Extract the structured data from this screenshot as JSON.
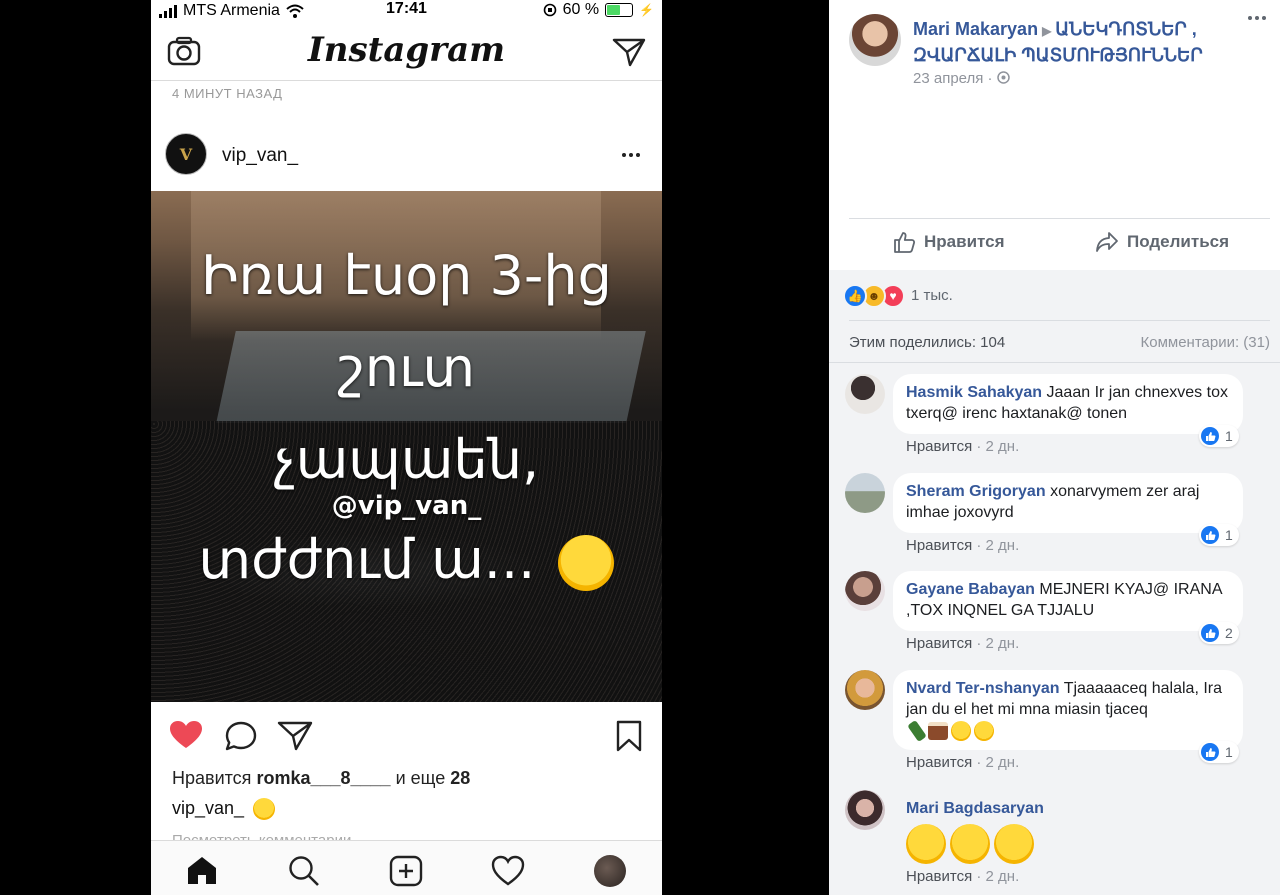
{
  "status_bar": {
    "carrier": "MTS Armenia",
    "time": "17:41",
    "battery": "60 %"
  },
  "instagram": {
    "logo": "Instagram",
    "posted_ago": "4 МИНУТ НАЗАД",
    "username": "vip_van_",
    "avatar_letter": "V",
    "overlay": {
      "line1": "Իռա էսօր 3-ից",
      "line2": "շուտ",
      "line3": "չապաեն,",
      "handle": "@vip_van_",
      "line4": "տժժում ա..."
    },
    "likes": {
      "prefix": "Нравится",
      "user": "romka___8____",
      "middle": "и еще",
      "count": "28"
    },
    "caption_user": "vip_van_",
    "view_comments": "Посмотреть комментарии"
  },
  "facebook": {
    "author": "Mari Makaryan",
    "group": "ԱՆԵԿԴՈՏՆԵՐ , ԶՎԱՐՃԱԼԻ ՊԱՏՄՈՒԹՅՈՒՆՆԵՐ",
    "date": "23 апреля · ",
    "like_button": "Нравится",
    "share_button": "Поделиться",
    "reactions_count": "1 тыс.",
    "shared_label": "Этим поделились: 104",
    "comments_label": "Комментарии: (31)",
    "comments": [
      {
        "author": "Hasmik Sahakyan",
        "text": "Jaaan Ir jan chnexves tox txerq@ irenc haxtanak@ tonen",
        "like": "Нравится",
        "time": "2 дн.",
        "likes": "1"
      },
      {
        "author": "Sheram Grigoryan",
        "text": "xonarvymem zer araj imhae joxovyrd",
        "like": "Нравится",
        "time": "2 дн.",
        "likes": "1"
      },
      {
        "author": "Gayane Babayan",
        "text": "MEJNERI KYAJ@ IRANA ,TOX INQNEL GA TJJALU",
        "like": "Нравится",
        "time": "2 дн.",
        "likes": "2"
      },
      {
        "author": "Nvard Ter-nshanyan",
        "text": "Tjaaaaaceq halala, Ira jan du el het mi mna miasin tjaceq",
        "like": "Нравится",
        "time": "2 дн.",
        "likes": "1"
      },
      {
        "author": "Mari Bagdasaryan",
        "text": "",
        "like": "Нравится",
        "time": "2 дн."
      }
    ]
  }
}
